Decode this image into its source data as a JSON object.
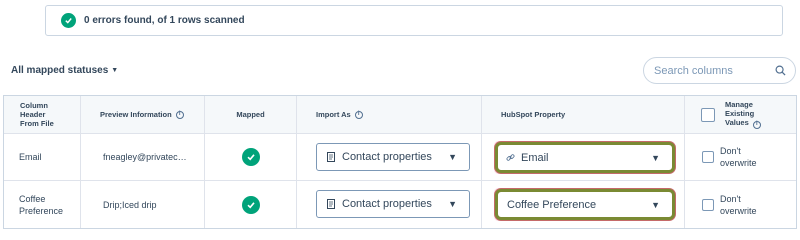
{
  "banner": {
    "message": "0 errors found, of 1 rows scanned",
    "icon": "check-circle-icon",
    "color": "#00a37a"
  },
  "filter": {
    "label": "All mapped statuses",
    "icon": "caret-down-icon"
  },
  "search": {
    "placeholder": "Search columns",
    "icon": "search-icon"
  },
  "table": {
    "headers": {
      "column_header": "Column Header From File",
      "preview": "Preview Information",
      "mapped": "Mapped",
      "import_as": "Import As",
      "hubspot_property": "HubSpot Property",
      "manage": "Manage Existing Values"
    },
    "rows": [
      {
        "column": "Email",
        "preview": "fneagley@privatec…",
        "mapped": true,
        "import_as": "Contact properties",
        "property": "Email",
        "overwrite": "Don't overwrite",
        "overwrite_checked": false
      },
      {
        "column": "Coffee Preference",
        "preview": "Drip;Iced drip",
        "mapped": true,
        "import_as": "Contact properties",
        "property": "Coffee Preference",
        "overwrite": "Don't overwrite",
        "overwrite_checked": false
      }
    ]
  },
  "colors": {
    "success": "#00a37a",
    "highlight_border": "#7a8a33",
    "highlight_bg": "#fde8ef",
    "text": "#33475b"
  }
}
